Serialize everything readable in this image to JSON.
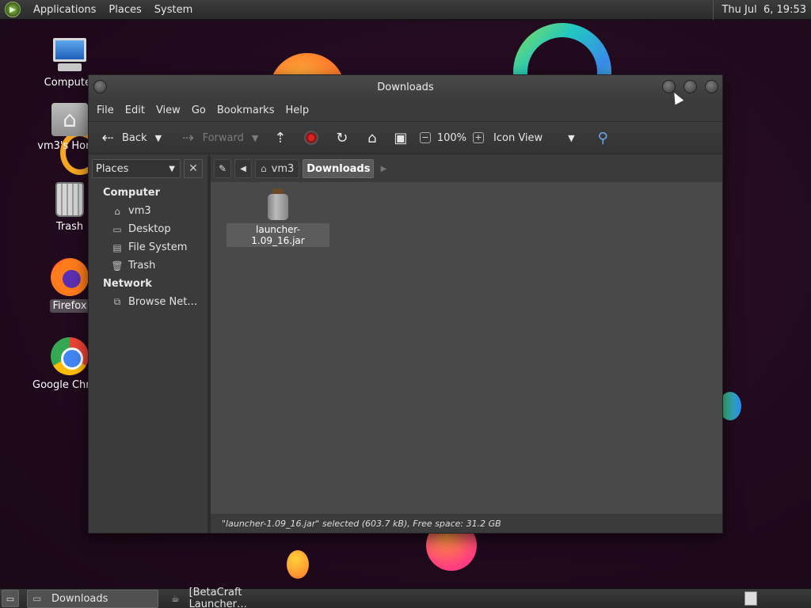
{
  "top_panel": {
    "menus": [
      "Applications",
      "Places",
      "System"
    ],
    "clock": "Thu Jul  6, 19:53"
  },
  "desktop": {
    "icons": [
      {
        "label": "Computer",
        "icon": "computer-icon"
      },
      {
        "label": "vm3's Home",
        "icon": "home-folder-icon"
      },
      {
        "label": "Trash",
        "icon": "trash-icon"
      },
      {
        "label": "Firefox",
        "icon": "firefox-icon"
      },
      {
        "label": "Google Chrome",
        "icon": "chrome-icon"
      }
    ]
  },
  "window": {
    "title": "Downloads",
    "menu": [
      "File",
      "Edit",
      "View",
      "Go",
      "Bookmarks",
      "Help"
    ],
    "toolbar": {
      "back": "Back",
      "forward": "Forward",
      "zoom": "100%",
      "view_mode": "Icon View"
    },
    "sidebar": {
      "selector": "Places",
      "sections": [
        {
          "heading": "Computer",
          "items": [
            "vm3",
            "Desktop",
            "File System",
            "Trash"
          ]
        },
        {
          "heading": "Network",
          "items": [
            "Browse Net…"
          ]
        }
      ]
    },
    "pathbar": {
      "crumbs": [
        "vm3",
        "Downloads"
      ]
    },
    "files": [
      {
        "name": "launcher-1.09_16.jar",
        "icon": "jar-file-icon",
        "selected": true
      }
    ],
    "status": "\"launcher-1.09_16.jar\" selected (603.7 kB), Free space: 31.2 GB"
  },
  "taskbar": {
    "tasks": [
      "Downloads",
      "[BetaCraft Launcher…"
    ]
  }
}
